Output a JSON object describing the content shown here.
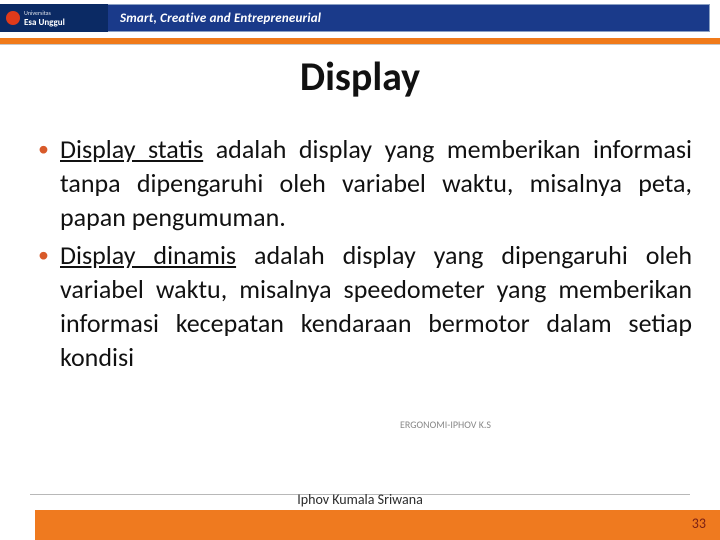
{
  "header": {
    "logo": {
      "univ": "Universitas",
      "name": "Esa Unggul"
    },
    "tagline": "Smart, Creative and Entrepreneurial"
  },
  "title": "Display",
  "bullets": [
    {
      "html": "<u>Display statis</u> adalah display yang memberikan informasi tanpa dipengaruhi oleh variabel waktu, misalnya peta, papan pengumuman."
    },
    {
      "html": "<u>Display dinamis</u> adalah display yang dipengaruhi oleh variabel waktu, misalnya speedometer yang memberikan informasi kecepatan kendaraan bermotor dalam setiap kondisi"
    }
  ],
  "small_credit": "ERGONOMI-IPHOV K.S",
  "footer": {
    "author": "Iphov Kumala Sriwana",
    "page": "33"
  }
}
